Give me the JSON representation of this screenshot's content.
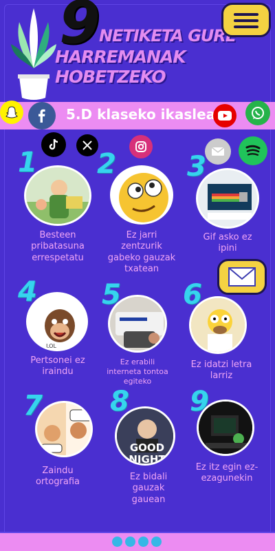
{
  "header": {
    "number": "9",
    "title_line1": "NETIKETA GURE",
    "title_line2": "HARREMANAK HOBETZEKO"
  },
  "banner": {
    "text": "5.D klaseko ikasleak"
  },
  "social": [
    "snapchat-icon",
    "facebook-icon",
    "youtube-icon",
    "whatsapp-icon",
    "tiktok-icon",
    "x-icon",
    "instagram-icon",
    "email-icon",
    "spotify-icon"
  ],
  "items": [
    {
      "num": "1",
      "caption_lines": [
        "Besteen",
        "pribatasuna",
        "errespetatu"
      ]
    },
    {
      "num": "2",
      "caption_lines": [
        "Ez jarri",
        "zentzurik",
        "gabeko gauzak",
        "txatean"
      ]
    },
    {
      "num": "3",
      "caption_lines": [
        "Gif asko ez",
        "ipini"
      ]
    },
    {
      "num": "4",
      "caption_lines": [
        "Pertsonei ez",
        "iraindu"
      ]
    },
    {
      "num": "5",
      "caption_lines": [
        "Ez erabili",
        "interneta tontoa",
        "egiteko"
      ]
    },
    {
      "num": "6",
      "caption_lines": [
        "Ez idatzi letra",
        "larriz"
      ]
    },
    {
      "num": "7",
      "caption_lines": [
        "Zaindu",
        "ortografia"
      ]
    },
    {
      "num": "8",
      "caption_lines": [
        "Ez bidali",
        "gauzak",
        "gauean"
      ]
    },
    {
      "num": "9",
      "caption_lines": [
        "Ez itz egin ez-",
        "ezagunekin"
      ]
    }
  ],
  "image_texts": {
    "good_night_1": "GOOD",
    "good_night_2": "NIGHT",
    "meme_word": "LOL"
  },
  "colors": {
    "background": "#4a2fd0",
    "banner": "#ec8cf2",
    "number": "#36d4ee",
    "caption": "#f1a5f5",
    "menu": "#f4d242"
  }
}
